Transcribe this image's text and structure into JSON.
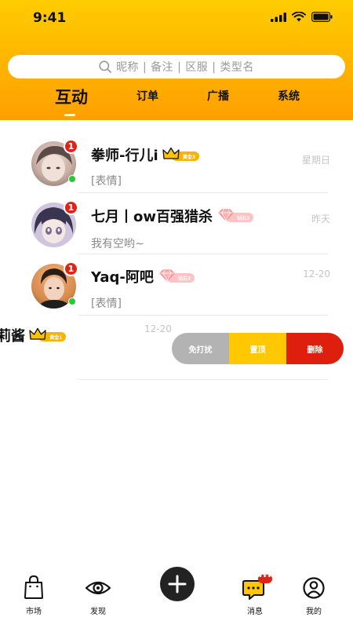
{
  "status_bar": {
    "time": "9:41"
  },
  "search": {
    "placeholder": "昵称 | 备注 | 区服 | 类型名"
  },
  "tabs": [
    {
      "label": "互动",
      "active": true
    },
    {
      "label": "订单",
      "active": false
    },
    {
      "label": "广播",
      "active": false
    },
    {
      "label": "系统",
      "active": false
    }
  ],
  "conversations": [
    {
      "name": "拳师-行儿i",
      "level_tag": "黄金3",
      "level_type": "crown",
      "preview": "[表情]",
      "time": "星期日",
      "unread": "1",
      "online": true
    },
    {
      "name": "七月丨ow百强猎杀",
      "level_tag": "钻石2",
      "level_type": "diamond",
      "preview": "我有空哟~",
      "time": "昨天",
      "unread": "1",
      "online": false
    },
    {
      "name": "Yaq-阿吧",
      "level_tag": "钻石3",
      "level_type": "diamond",
      "preview": "[表情]",
      "time": "12-20",
      "unread": "1",
      "online": true
    },
    {
      "name": "莉莉酱",
      "level_tag": "黄金1",
      "level_type": "crown",
      "preview": "",
      "time": "12-20",
      "unread": "",
      "online": false
    }
  ],
  "swipe_actions": {
    "mute": "免打扰",
    "pin": "置顶",
    "delete": "删除"
  },
  "bottom_nav": {
    "market": "市场",
    "discover": "发现",
    "messages": "消息",
    "profile": "我的",
    "messages_badge": "•••"
  },
  "colors": {
    "header_top": "#ffcc00",
    "header_bottom": "#ff9f00",
    "badge_red": "#e22214",
    "online_green": "#22cc33",
    "mute_gray": "#b3b3b3",
    "pin_yellow": "#ffc800",
    "delete_red": "#de1f0d"
  }
}
